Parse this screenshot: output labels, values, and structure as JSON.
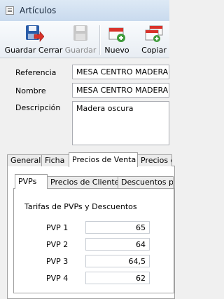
{
  "window": {
    "title": "Artículos"
  },
  "toolbar": {
    "buttons": [
      {
        "label": "Guardar Cerrar",
        "icon": "save-close-icon",
        "enabled": true
      },
      {
        "label": "Guardar",
        "icon": "save-icon",
        "enabled": false
      },
      {
        "label": "Nuevo",
        "icon": "new-icon",
        "enabled": true
      },
      {
        "label": "Copiar",
        "icon": "copy-icon",
        "enabled": true
      }
    ]
  },
  "form": {
    "referencia": {
      "label": "Referencia",
      "value": "MESA CENTRO MADERA"
    },
    "nombre": {
      "label": "Nombre",
      "value": "MESA CENTRO MADERA"
    },
    "descripcion": {
      "label": "Descripción",
      "value": "Madera oscura"
    }
  },
  "tabs": {
    "items": [
      "General",
      "Ficha",
      "Precios de Venta",
      "Precios de"
    ],
    "active": "Precios de Venta"
  },
  "inner_tabs": {
    "items": [
      "PVPs",
      "Precios de Clientes",
      "Descuentos po"
    ],
    "active": "PVPs"
  },
  "pvps": {
    "heading": "Tarifas de PVPs y Descuentos",
    "rows": [
      {
        "label": "PVP 1",
        "value": "65"
      },
      {
        "label": "PVP 2",
        "value": "64"
      },
      {
        "label": "PVP 3",
        "value": "64,5"
      },
      {
        "label": "PVP 4",
        "value": "62"
      }
    ]
  },
  "colors": {
    "titlebar": "#c9daee",
    "save_blue": "#2a5ca8",
    "accent_red": "#d9322a",
    "accent_green": "#3f9b3a"
  }
}
